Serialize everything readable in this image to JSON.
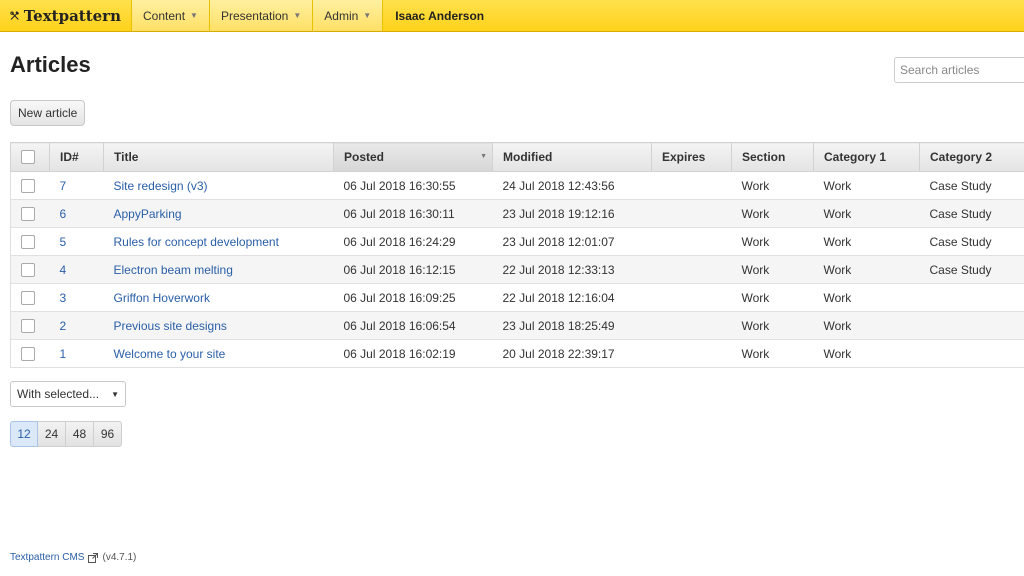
{
  "brand": {
    "name": "Textpattern"
  },
  "nav": {
    "tabs": [
      {
        "label": "Content"
      },
      {
        "label": "Presentation"
      },
      {
        "label": "Admin"
      }
    ],
    "user": "Isaac Anderson"
  },
  "page": {
    "title": "Articles",
    "search_placeholder": "Search articles",
    "new_button": "New article"
  },
  "table": {
    "headers": {
      "id": "ID#",
      "title": "Title",
      "posted": "Posted",
      "modified": "Modified",
      "expires": "Expires",
      "section": "Section",
      "category1": "Category 1",
      "category2": "Category 2"
    },
    "sorted_column": "posted",
    "rows": [
      {
        "id": "7",
        "title": "Site redesign (v3)",
        "posted": "06 Jul 2018 16:30:55",
        "modified": "24 Jul 2018 12:43:56",
        "expires": "",
        "section": "Work",
        "category1": "Work",
        "category2": "Case Study"
      },
      {
        "id": "6",
        "title": "AppyParking",
        "posted": "06 Jul 2018 16:30:11",
        "modified": "23 Jul 2018 19:12:16",
        "expires": "",
        "section": "Work",
        "category1": "Work",
        "category2": "Case Study"
      },
      {
        "id": "5",
        "title": "Rules for concept development",
        "posted": "06 Jul 2018 16:24:29",
        "modified": "23 Jul 2018 12:01:07",
        "expires": "",
        "section": "Work",
        "category1": "Work",
        "category2": "Case Study"
      },
      {
        "id": "4",
        "title": "Electron beam melting",
        "posted": "06 Jul 2018 16:12:15",
        "modified": "22 Jul 2018 12:33:13",
        "expires": "",
        "section": "Work",
        "category1": "Work",
        "category2": "Case Study"
      },
      {
        "id": "3",
        "title": "Griffon Hoverwork",
        "posted": "06 Jul 2018 16:09:25",
        "modified": "22 Jul 2018 12:16:04",
        "expires": "",
        "section": "Work",
        "category1": "Work",
        "category2": ""
      },
      {
        "id": "2",
        "title": "Previous site designs",
        "posted": "06 Jul 2018 16:06:54",
        "modified": "23 Jul 2018 18:25:49",
        "expires": "",
        "section": "Work",
        "category1": "Work",
        "category2": ""
      },
      {
        "id": "1",
        "title": "Welcome to your site",
        "posted": "06 Jul 2018 16:02:19",
        "modified": "20 Jul 2018 22:39:17",
        "expires": "",
        "section": "Work",
        "category1": "Work",
        "category2": ""
      }
    ]
  },
  "bulk_action": {
    "selected": "With selected..."
  },
  "pagination": {
    "options": [
      "12",
      "24",
      "48",
      "96"
    ],
    "active": "12"
  },
  "footer": {
    "link": "Textpattern CMS",
    "version": "(v4.7.1)"
  },
  "colors": {
    "topbar": "#ffd21a",
    "link": "#2a5fa8",
    "active_page": "#dbe8f7"
  },
  "icons": {
    "brand": "hammer-wrench-icon",
    "external": "external-link-icon"
  }
}
